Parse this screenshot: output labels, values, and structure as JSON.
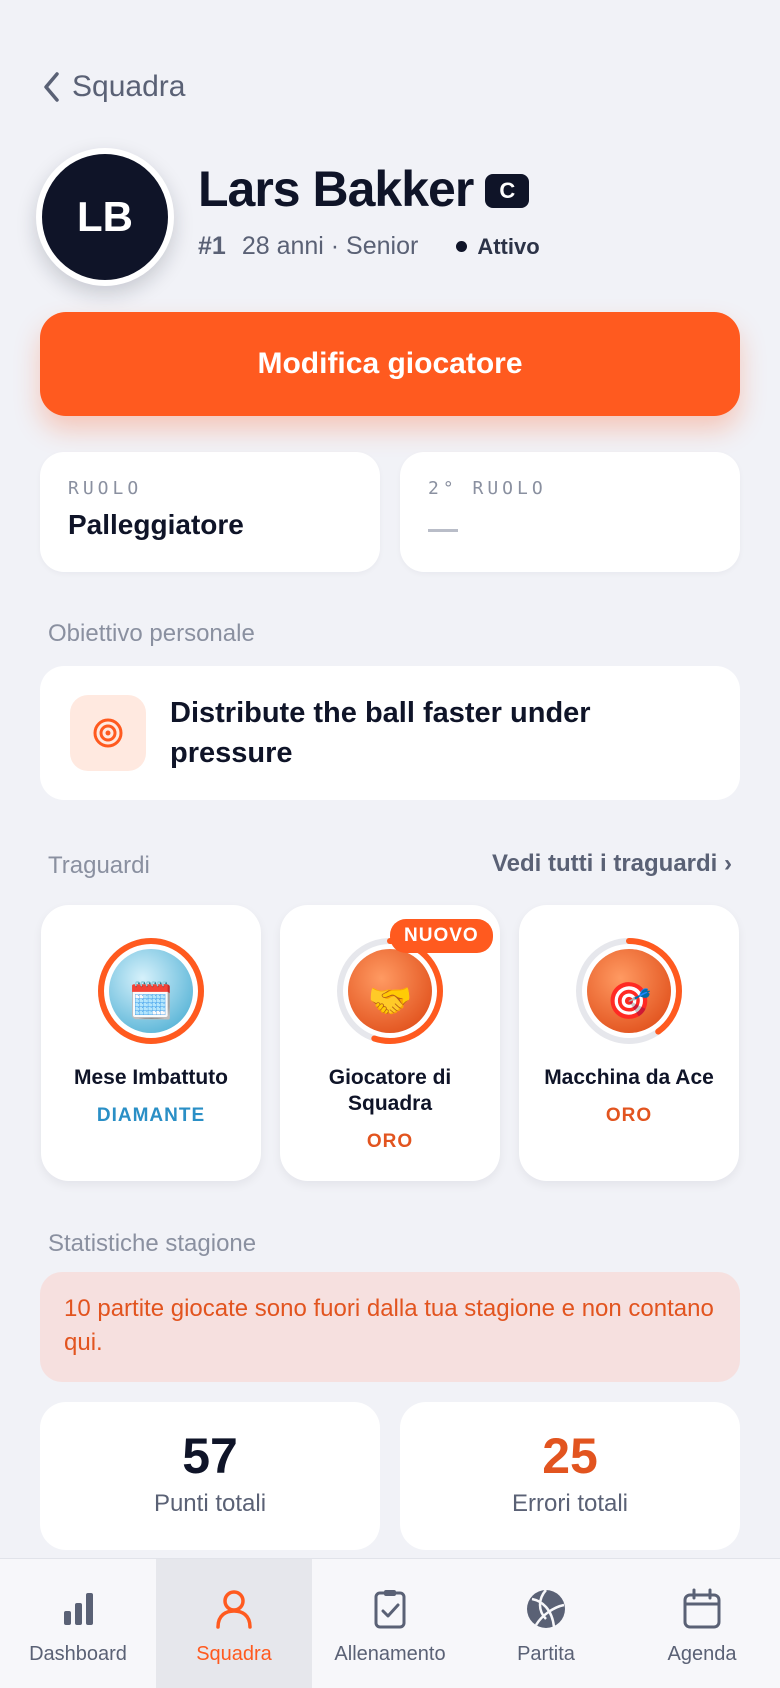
{
  "nav": {
    "back_label": "Squadra"
  },
  "player": {
    "initials": "LB",
    "name": "Lars Bakker",
    "captain_badge": "C",
    "number": "#1",
    "age_category": "28 anni · Senior",
    "status": "Attivo"
  },
  "actions": {
    "edit_label": "Modifica giocatore"
  },
  "roles": {
    "primary_label": "RUOLO",
    "primary_value": "Palleggiatore",
    "secondary_label": "2° RUOLO"
  },
  "goal": {
    "section_title": "Obiettivo personale",
    "text": "Distribute the ball faster under pressure",
    "icon": "target-icon"
  },
  "achievements": {
    "section_title": "Traguardi",
    "see_all": "Vedi tutti i traguardi ›",
    "items": [
      {
        "name": "Mese Imbattuto",
        "tier": "DIAMANTE",
        "tier_color": "#2a8fc6",
        "emoji": "🗓️",
        "progress": 1.0,
        "is_new": false
      },
      {
        "name": "Giocatore di Squadra",
        "tier": "ORO",
        "tier_color": "#e2541f",
        "emoji": "🤝",
        "progress": 0.55,
        "is_new": true,
        "new_label": "NUOVO"
      },
      {
        "name": "Macchina da Ace",
        "tier": "ORO",
        "tier_color": "#e2541f",
        "emoji": "🎯",
        "progress": 0.4,
        "is_new": false
      }
    ]
  },
  "season": {
    "section_title": "Statistiche stagione",
    "notice": "10 partite giocate sono fuori dalla tua stagione e non contano qui.",
    "stats": [
      {
        "value": "57",
        "label": "Punti totali",
        "color": "#0f1428"
      },
      {
        "value": "25",
        "label": "Errori totali",
        "color": "#e2541f"
      }
    ]
  },
  "tabbar": {
    "items": [
      {
        "label": "Dashboard",
        "icon": "bar-chart-icon"
      },
      {
        "label": "Squadra",
        "icon": "person-icon",
        "active": true
      },
      {
        "label": "Allenamento",
        "icon": "clipboard-check-icon"
      },
      {
        "label": "Partita",
        "icon": "volleyball-icon"
      },
      {
        "label": "Agenda",
        "icon": "calendar-icon"
      }
    ]
  },
  "colors": {
    "accent": "#ff5a1f",
    "dark": "#0f1428",
    "background": "#f1f2f7"
  }
}
